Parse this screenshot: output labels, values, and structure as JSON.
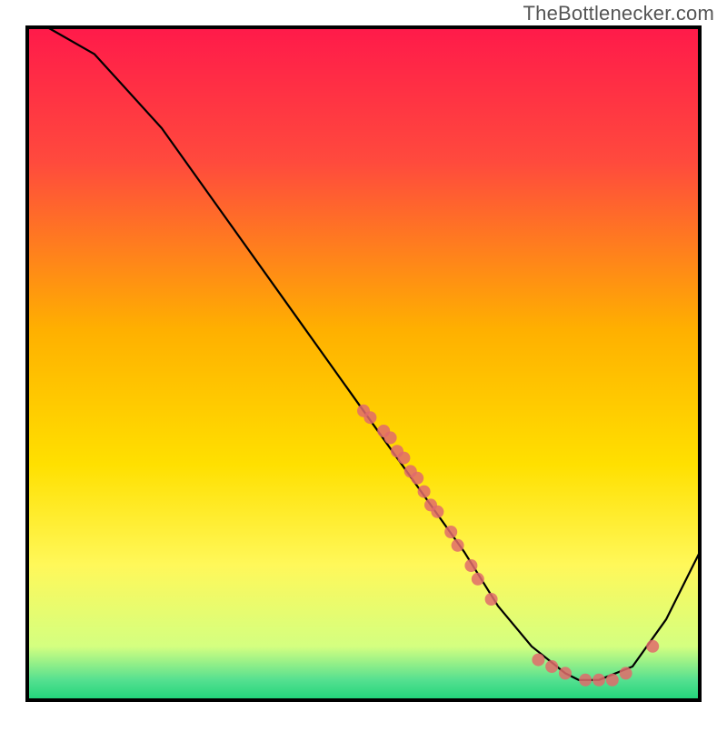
{
  "watermark": "TheBottlenecker.com",
  "chart_data": {
    "type": "line",
    "title": "",
    "xlabel": "",
    "ylabel": "",
    "xlim": [
      0,
      100
    ],
    "ylim": [
      0,
      100
    ],
    "grid": false,
    "legend": false,
    "background_gradient": {
      "stops": [
        {
          "offset": 0.0,
          "color": "#ff1a4a"
        },
        {
          "offset": 0.2,
          "color": "#ff4a3d"
        },
        {
          "offset": 0.45,
          "color": "#ffb000"
        },
        {
          "offset": 0.65,
          "color": "#ffe000"
        },
        {
          "offset": 0.8,
          "color": "#fff85a"
        },
        {
          "offset": 0.92,
          "color": "#d4ff80"
        },
        {
          "offset": 0.97,
          "color": "#55e090"
        },
        {
          "offset": 1.0,
          "color": "#1fd47a"
        }
      ]
    },
    "series": [
      {
        "name": "curve",
        "x": [
          3,
          10,
          20,
          30,
          40,
          50,
          55,
          60,
          65,
          70,
          75,
          80,
          82,
          85,
          90,
          95,
          100
        ],
        "y": [
          100,
          96,
          85,
          71,
          57,
          43,
          36,
          29,
          22,
          14,
          8,
          4,
          3,
          3,
          5,
          12,
          22
        ]
      }
    ],
    "scatter": [
      {
        "name": "points-on-slope",
        "color": "#e06b6b",
        "x": [
          50,
          51,
          53,
          54,
          55,
          56,
          57,
          58,
          59,
          60,
          61,
          63,
          64,
          66,
          67,
          69
        ],
        "y": [
          43,
          42,
          40,
          39,
          37,
          36,
          34,
          33,
          31,
          29,
          28,
          25,
          23,
          20,
          18,
          15
        ]
      },
      {
        "name": "points-in-valley",
        "color": "#e06b6b",
        "x": [
          76,
          78,
          80,
          83,
          85,
          87,
          89,
          93
        ],
        "y": [
          6,
          5,
          4,
          3,
          3,
          3,
          4,
          8
        ]
      }
    ]
  }
}
